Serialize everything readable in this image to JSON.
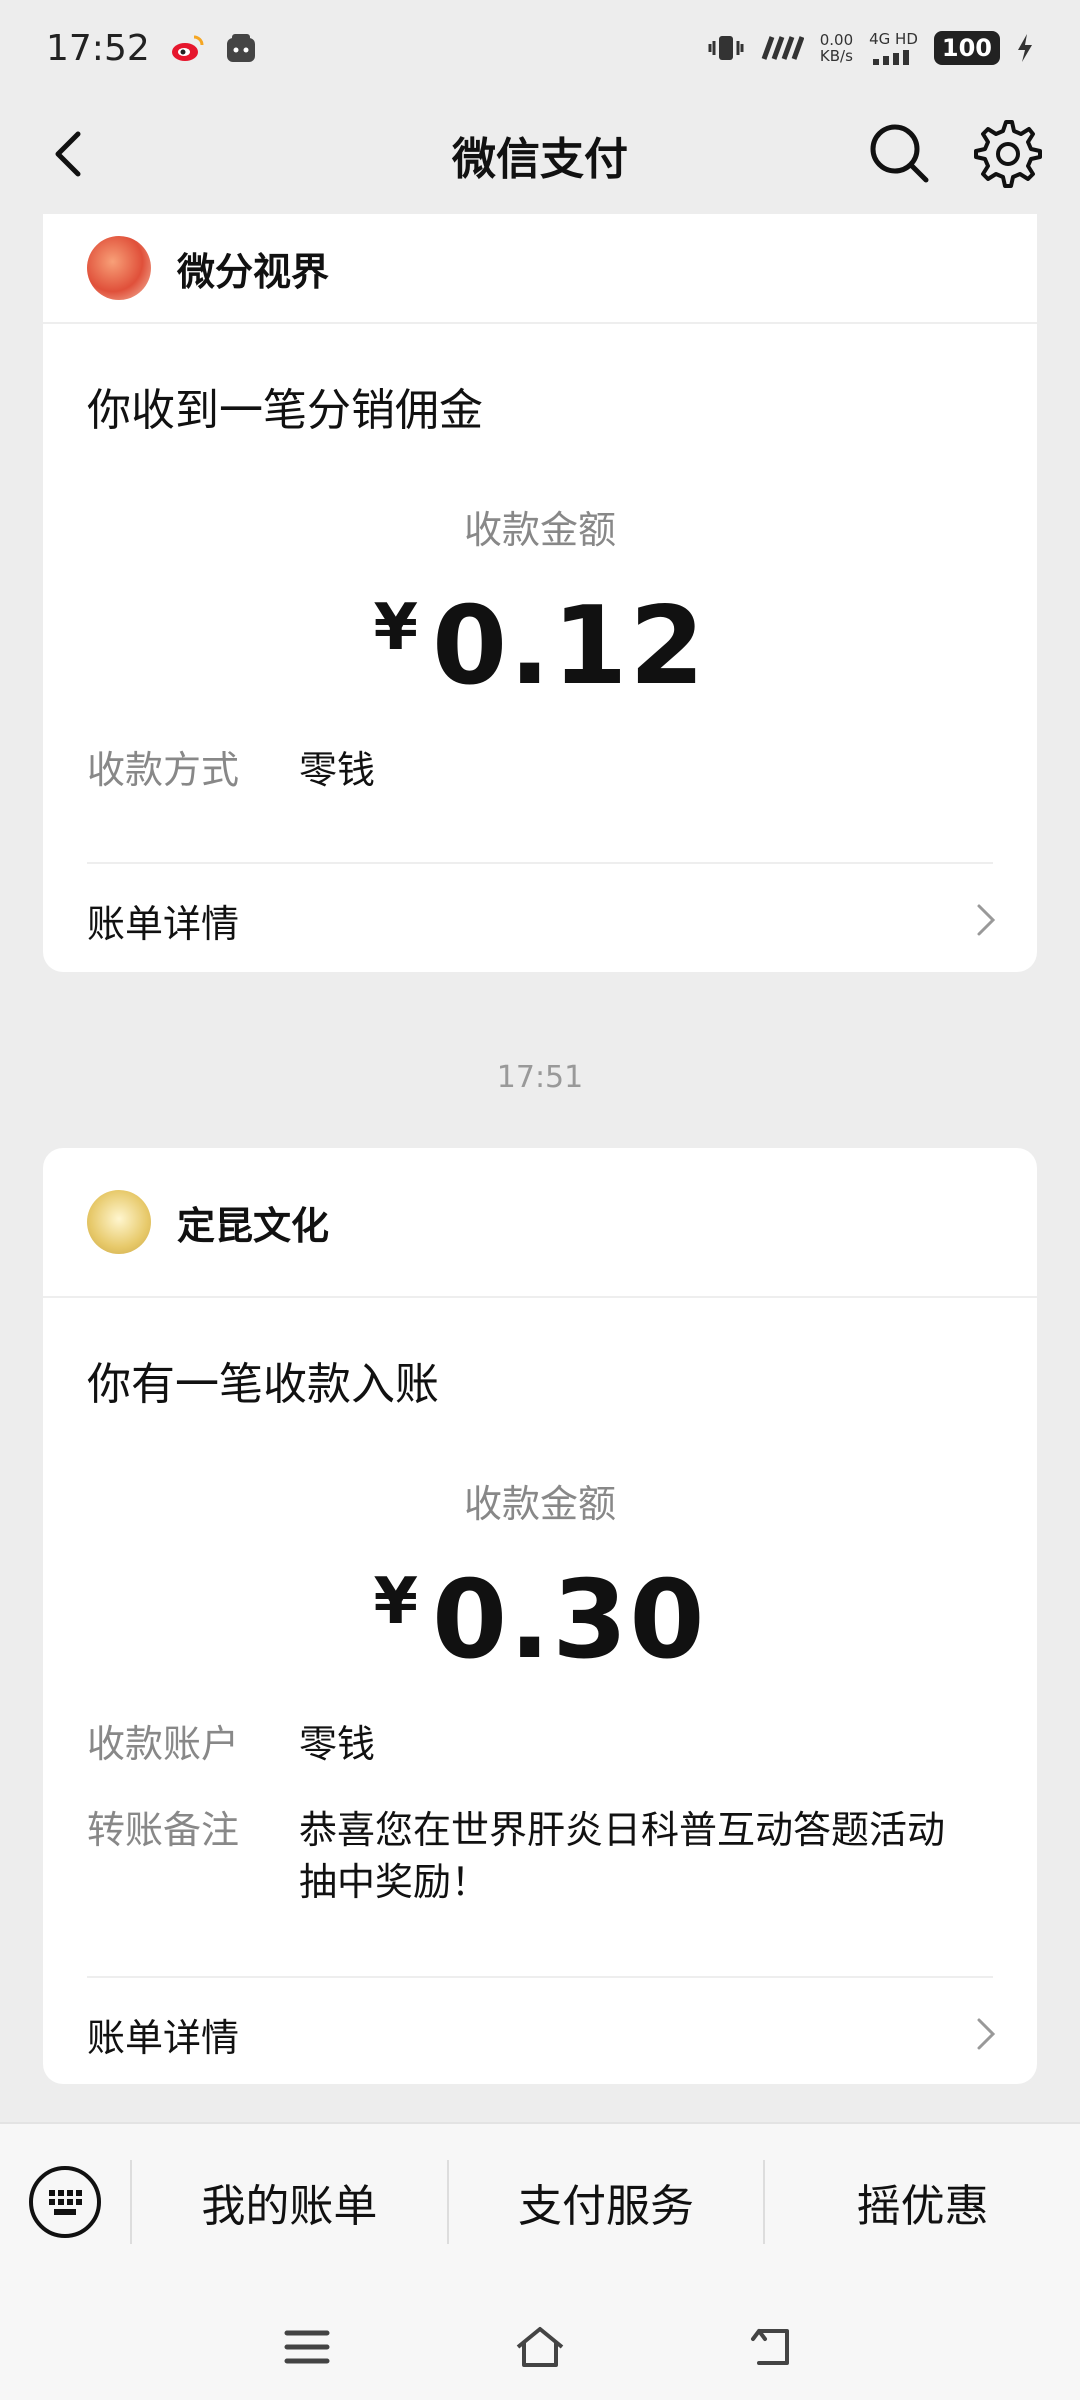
{
  "status_bar": {
    "time": "17:52",
    "net_speed_value": "0.00",
    "net_speed_unit": "KB/s",
    "network": "4G HD",
    "battery": "100"
  },
  "header": {
    "title": "微信支付"
  },
  "card1": {
    "org_name": "微分视界",
    "headline": "你收到一笔分销佣金",
    "amount_label": "收款金额",
    "currency": "¥",
    "amount": "0.12",
    "rows": [
      {
        "key": "收款方式",
        "value": "零钱"
      }
    ],
    "detail_label": "账单详情"
  },
  "timestamp": "17:51",
  "card2": {
    "org_name": "定昆文化",
    "headline": "你有一笔收款入账",
    "amount_label": "收款金额",
    "currency": "¥",
    "amount": "0.30",
    "rows": [
      {
        "key": "收款账户",
        "value": "零钱"
      },
      {
        "key": "转账备注",
        "value": "恭喜您在世界肝炎日科普互动答题活动抽中奖励！"
      }
    ],
    "detail_label": "账单详情"
  },
  "bottom_menu": {
    "items": [
      {
        "label": "我的账单"
      },
      {
        "label": "支付服务"
      },
      {
        "label": "摇优惠"
      }
    ]
  },
  "icons": {
    "back": "chevron-left-icon",
    "search": "search-icon",
    "settings": "gear-icon",
    "keyboard": "keyboard-icon",
    "nav": [
      "menu-icon",
      "home-icon",
      "back-icon"
    ]
  }
}
